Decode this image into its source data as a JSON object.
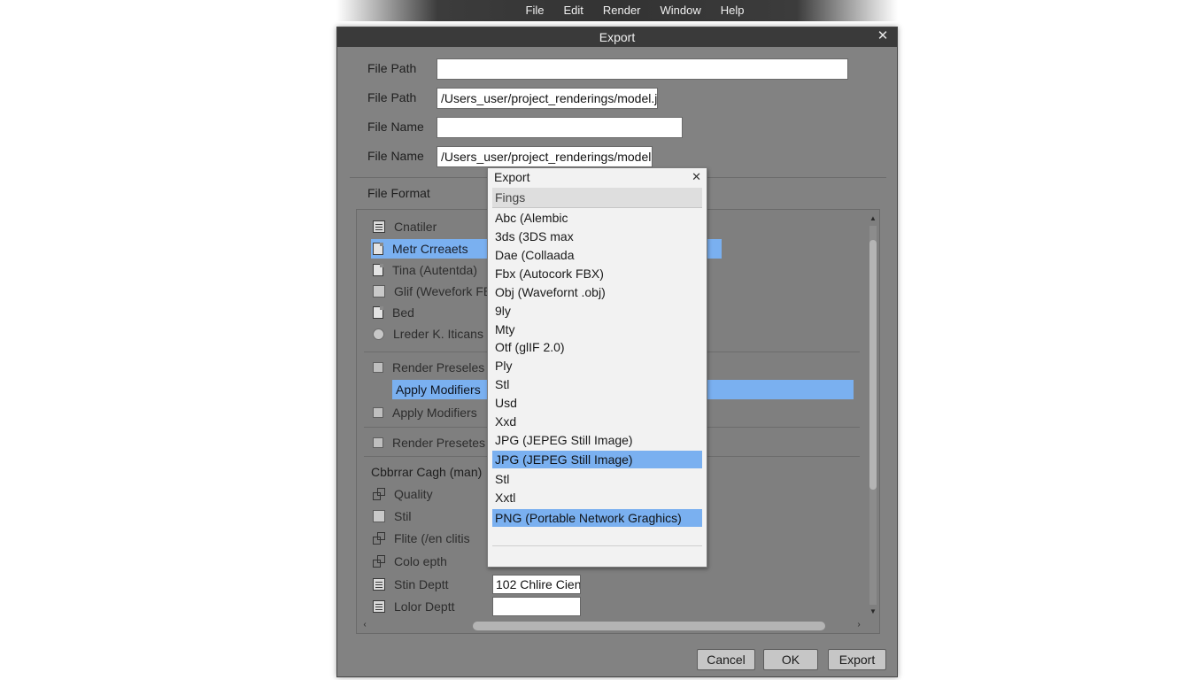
{
  "menubar": {
    "items": [
      "File",
      "Edit",
      "Render",
      "Window",
      "Help"
    ]
  },
  "window": {
    "title": "Export",
    "fields": [
      {
        "label": "File Path",
        "value": ""
      },
      {
        "label": "File Path",
        "value": "/Users_user/project_renderings/model.jpg"
      },
      {
        "label": "File Name",
        "value": ""
      },
      {
        "label": "File Name",
        "value": "/Users_user/project_renderings/model.jpg"
      }
    ],
    "file_format_label": "File Format",
    "list_items": [
      {
        "label": "Cnatiler",
        "icon": "list-icon"
      },
      {
        "label": "Metr Crreaets",
        "icon": "document-icon"
      },
      {
        "label": "Tina (Autentda)",
        "icon": "document-icon"
      },
      {
        "label": "Glif (Wevefork FB",
        "icon": "checkbox"
      },
      {
        "label": "Bed",
        "icon": "document-icon"
      },
      {
        "label": "Lreder K. Iticans",
        "icon": "radio"
      }
    ],
    "render_presets_1": "Render Preseles",
    "apply_modifiers_highlight": "Apply Modifiers",
    "apply_modifiers": "Apply Modifiers",
    "render_presets_2": "Render Presetes",
    "section2_title": "Cbbrrar Cagh (man)",
    "section2_items": [
      {
        "label": "Quality",
        "icon": "link-icon",
        "value": null
      },
      {
        "label": "Stil",
        "icon": "square-icon",
        "value": null
      },
      {
        "label": "Flite (/en clitis",
        "icon": "link-icon",
        "value": null
      },
      {
        "label": "Colo epth",
        "icon": "link-icon",
        "value": null
      },
      {
        "label": "Stin Deptt",
        "icon": "grid-icon",
        "value": "102 Chlire Cien"
      },
      {
        "label": "Lolor Deptt",
        "icon": "grid-icon",
        "value": ""
      }
    ],
    "buttons": {
      "cancel": "Cancel",
      "ok": "OK",
      "export": "Export"
    }
  },
  "popup": {
    "title": "Export",
    "header": "Fings",
    "options": [
      "Abc (Alembic",
      "3ds (3DS max",
      "Dae (Collaada",
      "Fbx (Autocork FBX)",
      "Obj (Wavefornt .obj)",
      "9ly",
      "Mty",
      "Otf (glIF 2.0)",
      "Ply",
      "Stl",
      "Usd",
      "Xxd",
      "JPG (JEPEG Still Image)",
      "JPG (JEPEG Still Image)",
      "Stl",
      "Xxtl",
      "PNG (Portable Network Graghics)"
    ],
    "selected_indices": [
      13,
      16
    ]
  },
  "colors": {
    "selection": "#7ab0f0",
    "window_bg": "#828282",
    "titlebar": "#3a3a3a"
  }
}
